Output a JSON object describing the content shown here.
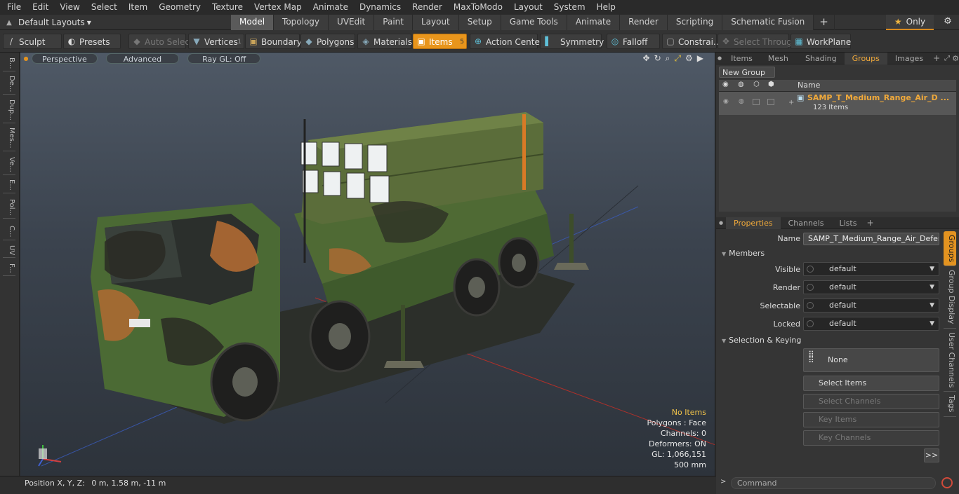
{
  "menu": [
    "File",
    "Edit",
    "View",
    "Select",
    "Item",
    "Geometry",
    "Texture",
    "Vertex Map",
    "Animate",
    "Dynamics",
    "Render",
    "MaxToModo",
    "Layout",
    "System",
    "Help"
  ],
  "layout_selector": "Default Layouts",
  "mode_tabs": [
    "Model",
    "Topology",
    "UVEdit",
    "Paint",
    "Layout",
    "Setup",
    "Game Tools",
    "Animate",
    "Render",
    "Scripting",
    "Schematic Fusion"
  ],
  "active_mode_tab": "Model",
  "only_label": "Only",
  "toolbar": {
    "sculpt": "Sculpt",
    "presets": "Presets",
    "auto_select": "Auto Select",
    "vertices": "Vertices",
    "vertices_count": "1",
    "boundary": "Boundary",
    "polygons": "Polygons",
    "materials": "Materials",
    "items": "Items",
    "items_count": "5",
    "action_center": "Action Center",
    "symmetry": "Symmetry",
    "falloff": "Falloff",
    "constraints": "Constrai...",
    "select_through": "Select Through",
    "workplane": "WorkPlane"
  },
  "left_tabs": [
    "B...",
    "De...",
    "Dup...",
    "Mes...",
    "Ve...",
    "E...",
    "Pol...",
    "C...",
    "UV",
    "F..."
  ],
  "viewport": {
    "perspective": "Perspective",
    "advanced": "Advanced",
    "raygl": "Ray GL: Off",
    "stats": {
      "selection": "No Items",
      "polygons": "Polygons : Face",
      "channels": "Channels: 0",
      "deformers": "Deformers: ON",
      "gl": "GL: 1,066,151",
      "scale": "500 mm"
    }
  },
  "position_bar": {
    "label": "Position X, Y, Z:",
    "value": "0 m, 1.58 m, -11 m"
  },
  "top_panel": {
    "tabs": [
      "Items",
      "Mesh ...",
      "Shading",
      "Groups",
      "Images"
    ],
    "active_tab": "Groups",
    "new_group": "New Group",
    "name_header": "Name",
    "group_name": "SAMP_T_Medium_Range_Air_D ...",
    "group_count": "123 Items"
  },
  "properties": {
    "tabs": [
      "Properties",
      "Channels",
      "Lists"
    ],
    "active_tab": "Properties",
    "name_label": "Name",
    "name_value": "SAMP_T_Medium_Range_Air_Defense",
    "members_header": "Members",
    "fields": [
      {
        "label": "Visible",
        "value": "default"
      },
      {
        "label": "Render",
        "value": "default"
      },
      {
        "label": "Selectable",
        "value": "default"
      },
      {
        "label": "Locked",
        "value": "default"
      }
    ],
    "selection_header": "Selection & Keying",
    "none_label": "None",
    "select_items": "Select Items",
    "select_channels": "Select Channels",
    "key_items": "Key Items",
    "key_channels": "Key Channels",
    "more": ">>",
    "side_tabs": [
      "Groups",
      "Group Display",
      "User Channels",
      "Tags"
    ]
  },
  "command_placeholder": "Command",
  "colors": {
    "accent": "#e8951c",
    "highlight_text": "#f2c44a"
  }
}
